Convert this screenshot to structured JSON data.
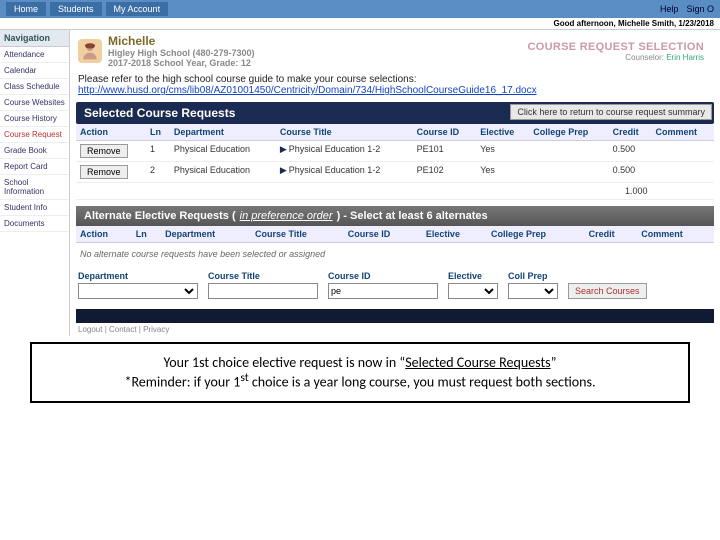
{
  "topbar": {
    "tabs": [
      "Home",
      "Students",
      "My Account"
    ],
    "help": "Help",
    "signout": "Sign O"
  },
  "greeting": "Good afternoon, Michelle Smith, 1/23/2018",
  "sidebar": {
    "header": "Navigation",
    "items": [
      "Attendance",
      "Calendar",
      "Class Schedule",
      "Course Websites",
      "Course History",
      "Course Request",
      "Grade Book",
      "Report Card",
      "School Information",
      "Student Info",
      "Documents"
    ]
  },
  "user": {
    "name": "Michelle",
    "school": "Higley High School (480-279-7300)",
    "year": "2017-2018 School Year, Grade: 12"
  },
  "page": {
    "title": "COURSE REQUEST SELECTION",
    "counselor_label": "Counselor:",
    "counselor": "Erin Harris"
  },
  "notice": {
    "text": "Please refer to the high school course guide to make your course selections:",
    "url": "http://www.husd.org/cms/lib08/AZ01001450/Centricity/Domain/734/HighSchoolCourseGuide16_17.docx"
  },
  "selected": {
    "band": "Selected Course Requests",
    "return_btn": "Click here to return to course request summary",
    "headers": {
      "action": "Action",
      "ln": "Ln",
      "dept": "Department",
      "title": "Course Title",
      "id": "Course ID",
      "elective": "Elective",
      "prep": "College Prep",
      "credit": "Credit",
      "comment": "Comment"
    },
    "rows": [
      {
        "ln": "1",
        "dept": "Physical Education",
        "title": "Physical Education 1-2",
        "id": "PE101",
        "elective": "Yes",
        "prep": "",
        "credit": "0.500",
        "comment": ""
      },
      {
        "ln": "2",
        "dept": "Physical Education",
        "title": "Physical Education 1-2",
        "id": "PE102",
        "elective": "Yes",
        "prep": "",
        "credit": "0.500",
        "comment": ""
      }
    ],
    "total_credit": "1.000",
    "remove_label": "Remove"
  },
  "alternates": {
    "prefix": "Alternate Elective Requests (",
    "inpref": "in preference order",
    "suffix": ") - Select at least 6 alternates",
    "headers": {
      "action": "Action",
      "ln": "Ln",
      "dept": "Department",
      "title": "Course Title",
      "id": "Course ID",
      "elective": "Elective",
      "prep": "College Prep",
      "credit": "Credit",
      "comment": "Comment"
    },
    "empty": "No alternate course requests have been selected or assigned"
  },
  "search": {
    "dept_label": "Department",
    "title_label": "Course Title",
    "id_label": "Course ID",
    "id_value": "pe",
    "elective_label": "Elective",
    "prep_label": "Coll Prep",
    "button": "Search Courses"
  },
  "footer": "Logout | Contact | Privacy",
  "callout": {
    "line1_a": "Your 1st choice elective request is now in “",
    "line1_u": "Selected Course Requests",
    "line1_b": "”",
    "line2_a": "*Reminder: if your 1",
    "line2_sup": "st",
    "line2_b": " choice is a year long course, you must request both sections."
  }
}
